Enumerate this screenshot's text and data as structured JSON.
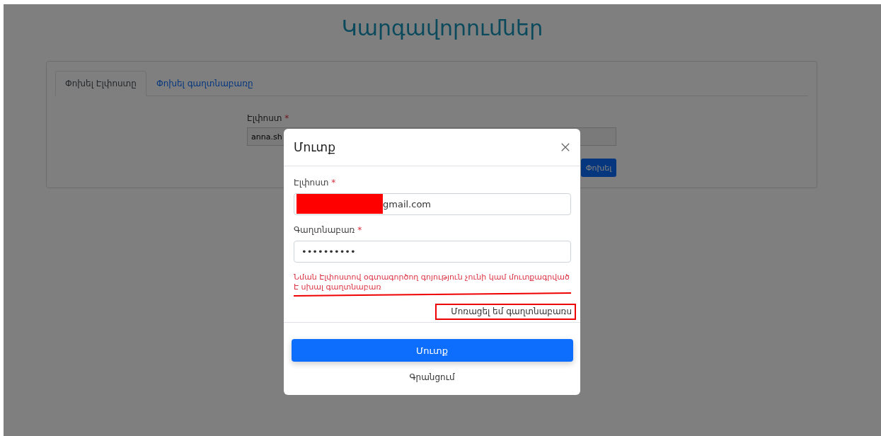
{
  "page": {
    "title": "Կարգավորումներ"
  },
  "tabs": [
    {
      "label": "Փոխել Էլփոստը",
      "selected": true
    },
    {
      "label": "Փոխել գաղտնաբառը",
      "selected": false
    }
  ],
  "email_form": {
    "label": "Էլփոստ",
    "required_mark": "*",
    "value": "anna.sh",
    "button": "Փոխել"
  },
  "login_dialog": {
    "title": "Մուտք",
    "fields": [
      {
        "label": "Էլփոստ",
        "required_mark": "*",
        "value": "gmail.com",
        "redacted": true
      },
      {
        "label": "Գաղտնաբառ",
        "required_mark": "*",
        "value": "••••••••••",
        "redacted": false
      }
    ],
    "error": "Նման Էլփոստով օգտագործող գոյություն չունի կամ մուտքագրված Է սխալ գաղտնաբառ",
    "forgot_password": "Մոռացել եմ գաղտնաբառս",
    "submit": "Մուտք",
    "register": "Գրանցում"
  }
}
